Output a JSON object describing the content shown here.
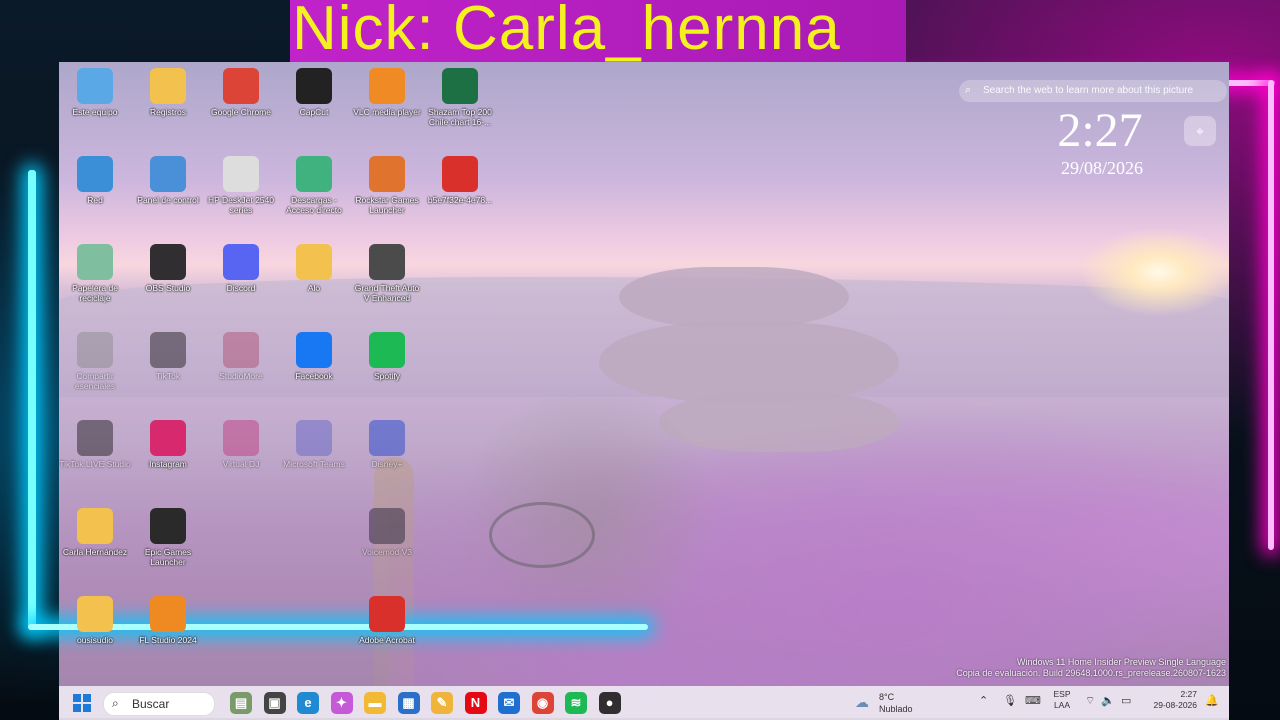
{
  "overlay": {
    "nick_text": "Nick: Carla_hernna"
  },
  "desktop": {
    "icons": [
      {
        "label": "Este equipo",
        "icon": "pc-icon",
        "color": "#5aa9e6"
      },
      {
        "label": "Registros",
        "icon": "folder-icon",
        "color": "#f2c14e"
      },
      {
        "label": "Google Chrome",
        "icon": "chrome-icon",
        "color": "#db4437"
      },
      {
        "label": "CapCut",
        "icon": "capcut-icon",
        "color": "#222222"
      },
      {
        "label": "VLC media player",
        "icon": "vlc-icon",
        "color": "#f08a24"
      },
      {
        "label": "Shazam Top 200 Chile chart 16-...",
        "icon": "excel-icon",
        "color": "#1d7044"
      },
      {
        "label": "Red",
        "icon": "network-icon",
        "color": "#3b8fd6"
      },
      {
        "label": "Panel de control",
        "icon": "control-panel-icon",
        "color": "#4a90d9"
      },
      {
        "label": "HP DeskJet 2540 series",
        "icon": "printer-icon",
        "color": "#dddddd"
      },
      {
        "label": "Descargas - Acceso directo",
        "icon": "download-folder-icon",
        "color": "#3fb27f"
      },
      {
        "label": "Rockstar Games Launcher",
        "icon": "rockstar-icon",
        "color": "#e0732e"
      },
      {
        "label": "b5e7f32e-4e78...",
        "icon": "pdf-icon",
        "color": "#d9302c"
      },
      {
        "label": "Papelera de reciclaje",
        "icon": "recycle-bin-icon",
        "color": "#7fbf9f"
      },
      {
        "label": "OBS Studio",
        "icon": "obs-icon",
        "color": "#302e31"
      },
      {
        "label": "Discord",
        "icon": "discord-icon",
        "color": "#5865f2"
      },
      {
        "label": "Alo",
        "icon": "folder-icon",
        "color": "#f2c14e"
      },
      {
        "label": "Grand Theft Auto V Enhanced",
        "icon": "gta-icon",
        "color": "#4b4b4b"
      },
      {
        "label": "Compartir esenciales",
        "icon": "share-icon",
        "color": "#888888"
      },
      {
        "label": "TikTok",
        "icon": "tiktok-icon",
        "color": "#111111"
      },
      {
        "label": "StudioMore",
        "icon": "studio-icon",
        "color": "#b0486a"
      },
      {
        "label": "Facebook",
        "icon": "facebook-icon",
        "color": "#1877f2"
      },
      {
        "label": "Spotify",
        "icon": "spotify-icon",
        "color": "#1db954"
      },
      {
        "label": "TikTok LIVE Studio",
        "icon": "tiktok-live-icon",
        "color": "#111111"
      },
      {
        "label": "Instagram",
        "icon": "instagram-icon",
        "color": "#d6296e"
      },
      {
        "label": "Virtual DJ",
        "icon": "virtualdj-icon",
        "color": "#c0307a"
      },
      {
        "label": "Microsoft Teams",
        "icon": "teams-icon",
        "color": "#5b5fc7"
      },
      {
        "label": "Disney+",
        "icon": "disney-icon",
        "color": "#113ccf"
      },
      {
        "label": "Carla Hernández",
        "icon": "user-folder-icon",
        "color": "#f2c14e"
      },
      {
        "label": "Epic Games Launcher",
        "icon": "epic-icon",
        "color": "#2a2a2a"
      },
      {
        "label": "Voicemod V3",
        "icon": "voicemod-icon",
        "color": "#1b1b2f"
      },
      {
        "label": "ousisudio",
        "icon": "folder-icon",
        "color": "#f2c14e"
      },
      {
        "label": "FL Studio 2024",
        "icon": "flstudio-icon",
        "color": "#ef8a22"
      },
      {
        "label": "Adobe Acrobat",
        "icon": "acrobat-icon",
        "color": "#d9302c"
      }
    ],
    "lens_search_text": "Search the web to learn more about this picture",
    "clock_time": "2:27",
    "clock_date": "29/08/2026",
    "watermark_line1": "Windows 11 Home Insider Preview Single Language",
    "watermark_line2": "Copia de evaluación. Build 29648.1000.rs_prerelease.260807-1623"
  },
  "taskbar": {
    "search_label": "Buscar",
    "apps": [
      {
        "name": "taskbar-widgets-icon",
        "color": "#7a9a6a",
        "glyph": "▤"
      },
      {
        "name": "task-view-icon",
        "color": "#444444",
        "glyph": "▣"
      },
      {
        "name": "edge-icon",
        "color": "#1f8ad1",
        "glyph": "e"
      },
      {
        "name": "copilot-icon",
        "color": "#c659d8",
        "glyph": "✦"
      },
      {
        "name": "file-explorer-icon",
        "color": "#f2b935",
        "glyph": "▬"
      },
      {
        "name": "store-icon",
        "color": "#2c6fc9",
        "glyph": "▦"
      },
      {
        "name": "notes-icon",
        "color": "#f0b43c",
        "glyph": "✎"
      },
      {
        "name": "netflix-icon",
        "color": "#e50914",
        "glyph": "N"
      },
      {
        "name": "outlook-icon",
        "color": "#1f6fd0",
        "glyph": "✉"
      },
      {
        "name": "chrome-taskbar-icon",
        "color": "#db4437",
        "glyph": "◉"
      },
      {
        "name": "spotify-taskbar-icon",
        "color": "#1db954",
        "glyph": "≋"
      },
      {
        "name": "obs-taskbar-icon",
        "color": "#302e31",
        "glyph": "●"
      }
    ],
    "weather_temp": "8°C",
    "weather_desc": "Nublado",
    "lang_line1": "ESP",
    "lang_line2": "LAA",
    "time": "2:27",
    "date": "29-08-2026"
  }
}
